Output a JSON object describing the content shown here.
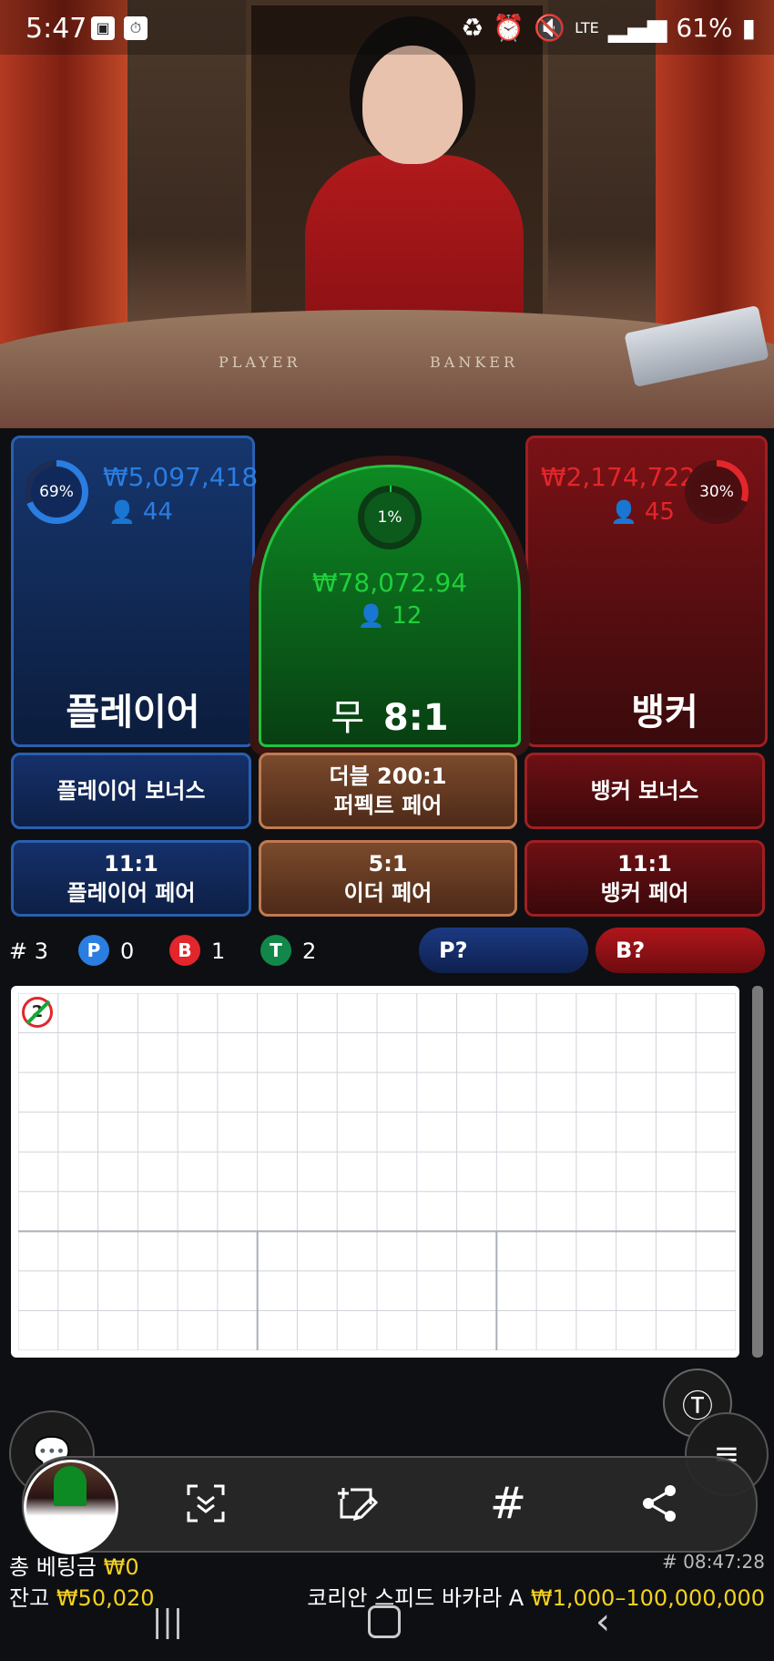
{
  "status_bar": {
    "time": "5:47",
    "network": "LTE",
    "battery": "61%"
  },
  "video": {
    "table_player_label": "PLAYER",
    "table_banker_label": "BANKER"
  },
  "player": {
    "percent": "69%",
    "percent_value": 69,
    "amount": "₩5,097,418",
    "count": "44",
    "label": "플레이어"
  },
  "banker": {
    "percent": "30%",
    "percent_value": 30,
    "amount": "₩2,174,722",
    "count": "45",
    "label": "뱅커"
  },
  "tie": {
    "percent": "1%",
    "percent_value": 1,
    "amount": "₩78,072.94",
    "count": "12",
    "label": "무",
    "odds": "8:1"
  },
  "side_bets": {
    "player_bonus": "플레이어 보너스",
    "perfect_pair_top": "더블 200:1",
    "perfect_pair_bottom": "퍼펙트 페어",
    "banker_bonus": "뱅커 보너스",
    "player_pair_odds": "11:1",
    "player_pair_label": "플레이어 페어",
    "either_pair_odds": "5:1",
    "either_pair_label": "이더 페어",
    "banker_pair_odds": "11:1",
    "banker_pair_label": "뱅커 페어"
  },
  "stats": {
    "round": "# 3",
    "p_letter": "P",
    "p_count": "0",
    "b_letter": "B",
    "b_count": "1",
    "t_letter": "T",
    "t_count": "2",
    "p_predict": "P?",
    "b_predict": "B?"
  },
  "road": {
    "first_cell_mark": "2"
  },
  "footer": {
    "total_bet_label": "총 베팅금",
    "total_bet_value": "₩0",
    "balance_label": "잔고",
    "balance_value": "₩50,020",
    "round_id": "# 08:47:28",
    "table_name": "코리안 스피드 바카라 A",
    "limits": "₩1,000–100,000,000"
  },
  "colors": {
    "player": "#2a7de1",
    "banker": "#e2262b",
    "tie": "#1fcf3a",
    "accent": "#f4d21f"
  }
}
